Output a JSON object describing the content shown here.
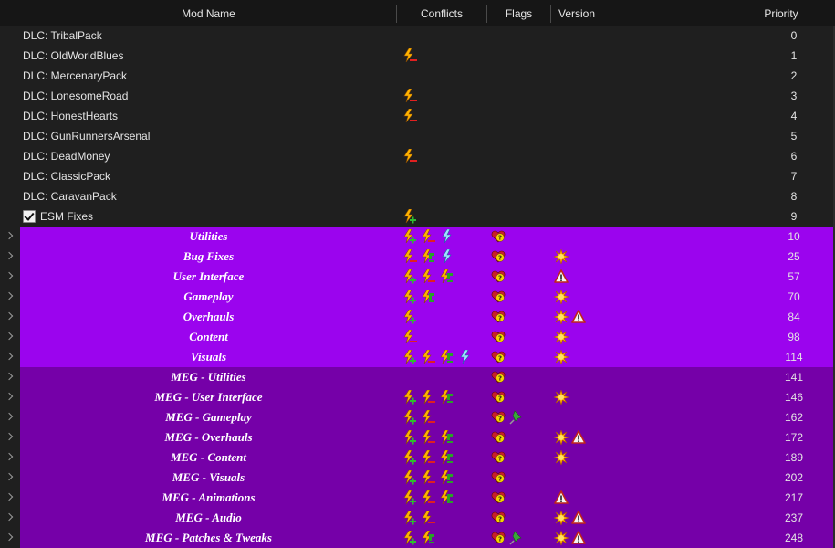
{
  "columns": {
    "mod_name": "Mod Name",
    "conflicts": "Conflicts",
    "flags": "Flags",
    "version": "Version",
    "priority": "Priority"
  },
  "colors": {
    "separator_light": "#9b04ee",
    "separator_dark": "#7500a8",
    "background": "#1f1f1f"
  },
  "rows": [
    {
      "name": "DLC: TribalPack",
      "priority": "0",
      "kind": "dlc",
      "conflicts": [],
      "flags": [],
      "version": []
    },
    {
      "name": "DLC: OldWorldBlues",
      "priority": "1",
      "kind": "dlc",
      "conflicts": [
        "bolt-minus"
      ],
      "flags": [],
      "version": []
    },
    {
      "name": "DLC: MercenaryPack",
      "priority": "2",
      "kind": "dlc",
      "conflicts": [],
      "flags": [],
      "version": []
    },
    {
      "name": "DLC: LonesomeRoad",
      "priority": "3",
      "kind": "dlc",
      "conflicts": [
        "bolt-minus"
      ],
      "flags": [],
      "version": []
    },
    {
      "name": "DLC: HonestHearts",
      "priority": "4",
      "kind": "dlc",
      "conflicts": [
        "bolt-minus"
      ],
      "flags": [],
      "version": []
    },
    {
      "name": "DLC: GunRunnersArsenal",
      "priority": "5",
      "kind": "dlc",
      "conflicts": [],
      "flags": [],
      "version": []
    },
    {
      "name": "DLC: DeadMoney",
      "priority": "6",
      "kind": "dlc",
      "conflicts": [
        "bolt-minus"
      ],
      "flags": [],
      "version": []
    },
    {
      "name": "DLC: ClassicPack",
      "priority": "7",
      "kind": "dlc",
      "conflicts": [],
      "flags": [],
      "version": []
    },
    {
      "name": "DLC: CaravanPack",
      "priority": "8",
      "kind": "dlc",
      "conflicts": [],
      "flags": [],
      "version": []
    },
    {
      "name": "ESM Fixes",
      "priority": "9",
      "kind": "mod",
      "checked": true,
      "conflicts": [
        "bolt-plus"
      ],
      "flags": [],
      "version": []
    },
    {
      "name": "Utilities",
      "priority": "10",
      "kind": "sep1",
      "conflicts": [
        "bolt-plus",
        "bolt-minus",
        "bolt-blue"
      ],
      "flags": [
        "heart-question"
      ],
      "version": []
    },
    {
      "name": "Bug Fixes",
      "priority": "25",
      "kind": "sep1",
      "conflicts": [
        "bolt-minus",
        "bolt-plus-green",
        "bolt-blue"
      ],
      "flags": [
        "heart-question"
      ],
      "version": [
        "starburst"
      ]
    },
    {
      "name": "User Interface",
      "priority": "57",
      "kind": "sep1",
      "conflicts": [
        "bolt-plus",
        "bolt-minus",
        "bolt-plus-green"
      ],
      "flags": [
        "heart-question"
      ],
      "version": [
        "warning"
      ]
    },
    {
      "name": "Gameplay",
      "priority": "70",
      "kind": "sep1",
      "conflicts": [
        "bolt-plus",
        "bolt-plus-green"
      ],
      "flags": [
        "heart-question"
      ],
      "version": [
        "starburst"
      ]
    },
    {
      "name": "Overhauls",
      "priority": "84",
      "kind": "sep1",
      "conflicts": [
        "bolt-plus"
      ],
      "flags": [
        "heart-question"
      ],
      "version": [
        "starburst",
        "warning"
      ]
    },
    {
      "name": "Content",
      "priority": "98",
      "kind": "sep1",
      "conflicts": [
        "bolt-minus"
      ],
      "flags": [
        "heart-question"
      ],
      "version": [
        "starburst"
      ]
    },
    {
      "name": "Visuals",
      "priority": "114",
      "kind": "sep1",
      "conflicts": [
        "bolt-plus",
        "bolt-minus",
        "bolt-plus-green",
        "bolt-blue"
      ],
      "flags": [
        "heart-question"
      ],
      "version": [
        "starburst"
      ]
    },
    {
      "name": "MEG - Utilities",
      "priority": "141",
      "kind": "sep2",
      "conflicts": [],
      "flags": [
        "heart-question"
      ],
      "version": []
    },
    {
      "name": "MEG - User Interface",
      "priority": "146",
      "kind": "sep2",
      "conflicts": [
        "bolt-plus",
        "bolt-minus",
        "bolt-plus-green"
      ],
      "flags": [
        "heart-question"
      ],
      "version": [
        "starburst"
      ]
    },
    {
      "name": "MEG - Gameplay",
      "priority": "162",
      "kind": "sep2",
      "conflicts": [
        "bolt-plus",
        "bolt-minus"
      ],
      "flags": [
        "heart-question",
        "pin"
      ],
      "version": []
    },
    {
      "name": "MEG - Overhauls",
      "priority": "172",
      "kind": "sep2",
      "conflicts": [
        "bolt-plus",
        "bolt-minus",
        "bolt-plus-green"
      ],
      "flags": [
        "heart-question"
      ],
      "version": [
        "starburst",
        "warning"
      ]
    },
    {
      "name": "MEG - Content",
      "priority": "189",
      "kind": "sep2",
      "conflicts": [
        "bolt-plus",
        "bolt-minus",
        "bolt-plus-green"
      ],
      "flags": [
        "heart-question"
      ],
      "version": [
        "starburst"
      ]
    },
    {
      "name": "MEG - Visuals",
      "priority": "202",
      "kind": "sep2",
      "conflicts": [
        "bolt-plus",
        "bolt-minus",
        "bolt-plus-green"
      ],
      "flags": [
        "heart-question"
      ],
      "version": []
    },
    {
      "name": "MEG - Animations",
      "priority": "217",
      "kind": "sep2",
      "conflicts": [
        "bolt-plus",
        "bolt-minus",
        "bolt-plus-green"
      ],
      "flags": [
        "heart-question"
      ],
      "version": [
        "warning"
      ]
    },
    {
      "name": "MEG - Audio",
      "priority": "237",
      "kind": "sep2",
      "conflicts": [
        "bolt-plus",
        "bolt-minus"
      ],
      "flags": [
        "heart-question"
      ],
      "version": [
        "starburst",
        "warning"
      ]
    },
    {
      "name": "MEG - Patches & Tweaks",
      "priority": "248",
      "kind": "sep2",
      "conflicts": [
        "bolt-plus",
        "bolt-plus-green"
      ],
      "flags": [
        "heart-question",
        "pin"
      ],
      "version": [
        "starburst",
        "warning"
      ]
    }
  ]
}
